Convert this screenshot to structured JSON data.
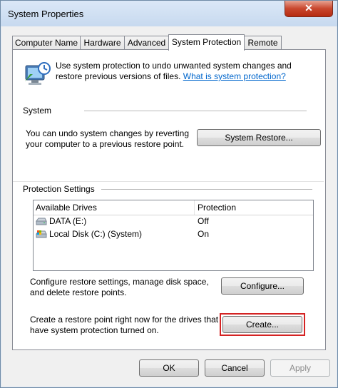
{
  "window": {
    "title": "System Properties",
    "close_glyph": "✕"
  },
  "tabs": [
    {
      "label": "Computer Name",
      "active": false
    },
    {
      "label": "Hardware",
      "active": false
    },
    {
      "label": "Advanced",
      "active": false
    },
    {
      "label": "System Protection",
      "active": true
    },
    {
      "label": "Remote",
      "active": false
    }
  ],
  "intro": {
    "text": "Use system protection to undo unwanted system changes and restore previous versions of files.",
    "link": "What is system protection?"
  },
  "system": {
    "heading": "System",
    "description": "You can undo system changes by reverting your computer to a previous restore point.",
    "restore_button": "System Restore..."
  },
  "protection": {
    "heading": "Protection Settings",
    "columns": [
      "Available Drives",
      "Protection"
    ],
    "rows": [
      {
        "drive": "DATA (E:)",
        "protection": "Off",
        "icon": "drive-icon"
      },
      {
        "drive": "Local Disk (C:) (System)",
        "protection": "On",
        "icon": "system-drive-icon"
      }
    ]
  },
  "configure": {
    "description": "Configure restore settings, manage disk space, and delete restore points.",
    "button": "Configure..."
  },
  "create": {
    "description": "Create a restore point right now for the drives that have system protection turned on.",
    "button": "Create..."
  },
  "dialog_buttons": {
    "ok": "OK",
    "cancel": "Cancel",
    "apply": "Apply"
  },
  "colors": {
    "link": "#0066cc",
    "highlight": "#d42323"
  }
}
